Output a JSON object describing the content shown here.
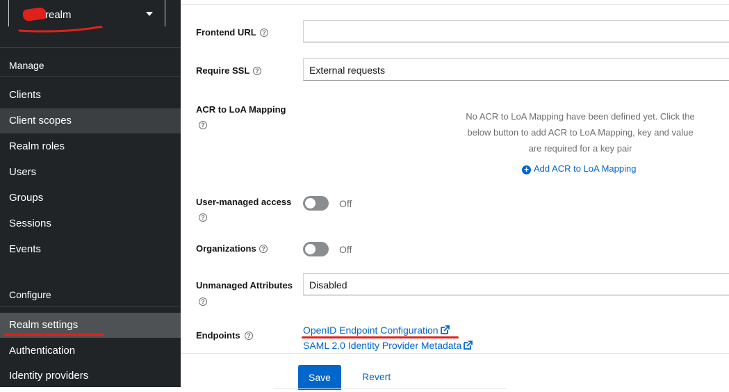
{
  "sidebar": {
    "realm_name": "realm",
    "section_manage": "Manage",
    "manage_items": [
      "Clients",
      "Client scopes",
      "Realm roles",
      "Users",
      "Groups",
      "Sessions",
      "Events"
    ],
    "section_configure": "Configure",
    "configure_items": [
      "Realm settings",
      "Authentication",
      "Identity providers"
    ]
  },
  "form": {
    "frontend_url_label": "Frontend URL",
    "frontend_url_value": "",
    "require_ssl_label": "Require SSL",
    "require_ssl_value": "External requests",
    "acr_label": "ACR to LoA Mapping",
    "acr_empty_text": "No ACR to LoA Mapping have been defined yet. Click the below button to add ACR to LoA Mapping, key and value are required for a key pair",
    "acr_add_label": "Add ACR to LoA Mapping",
    "user_managed_label": "User-managed access",
    "user_managed_state": "Off",
    "organizations_label": "Organizations",
    "organizations_state": "Off",
    "unmanaged_label": "Unmanaged Attributes",
    "unmanaged_value": "Disabled",
    "endpoints_label": "Endpoints",
    "endpoint_openid": "OpenID Endpoint Configuration",
    "endpoint_saml": "SAML 2.0 Identity Provider Metadata"
  },
  "actions": {
    "save": "Save",
    "revert": "Revert"
  },
  "colors": {
    "sidebar_bg": "#212427",
    "link": "#0066cc",
    "annotation_red": "#e0201a"
  }
}
